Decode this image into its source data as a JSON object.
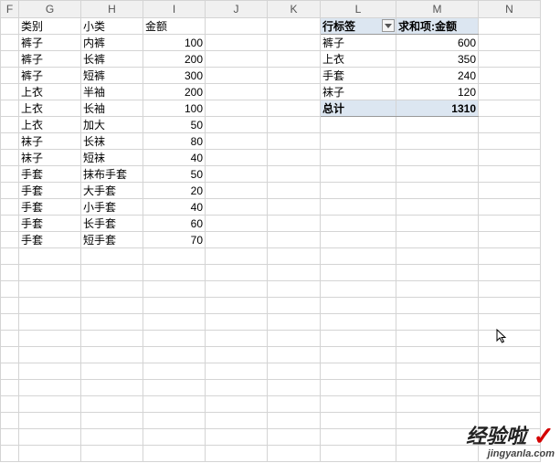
{
  "columns": [
    "F",
    "G",
    "H",
    "I",
    "J",
    "K",
    "L",
    "M",
    "N"
  ],
  "left_table": {
    "headers": {
      "g": "类别",
      "h": "小类",
      "i": "金额"
    },
    "rows": [
      {
        "g": "裤子",
        "h": "内裤",
        "i": 100
      },
      {
        "g": "裤子",
        "h": "长裤",
        "i": 200
      },
      {
        "g": "裤子",
        "h": "短裤",
        "i": 300
      },
      {
        "g": "上衣",
        "h": "半袖",
        "i": 200
      },
      {
        "g": "上衣",
        "h": "长袖",
        "i": 100
      },
      {
        "g": "上衣",
        "h": "加大",
        "i": 50
      },
      {
        "g": "袜子",
        "h": "长袜",
        "i": 80
      },
      {
        "g": "袜子",
        "h": "短袜",
        "i": 40
      },
      {
        "g": "手套",
        "h": "抹布手套",
        "i": 50
      },
      {
        "g": "手套",
        "h": "大手套",
        "i": 20
      },
      {
        "g": "手套",
        "h": "小手套",
        "i": 40
      },
      {
        "g": "手套",
        "h": "长手套",
        "i": 60
      },
      {
        "g": "手套",
        "h": "短手套",
        "i": 70
      }
    ]
  },
  "pivot": {
    "headers": {
      "l": "行标签",
      "m": "求和项:金额"
    },
    "rows": [
      {
        "l": "裤子",
        "m": 600
      },
      {
        "l": "上衣",
        "m": 350
      },
      {
        "l": "手套",
        "m": 240
      },
      {
        "l": "袜子",
        "m": 120
      }
    ],
    "total": {
      "l": "总计",
      "m": 1310
    }
  },
  "watermark": {
    "brand": "经验啦",
    "url": "jingyanla.com"
  },
  "icons": {
    "dropdown": "dropdown-triangle"
  },
  "blank_rows": 13
}
